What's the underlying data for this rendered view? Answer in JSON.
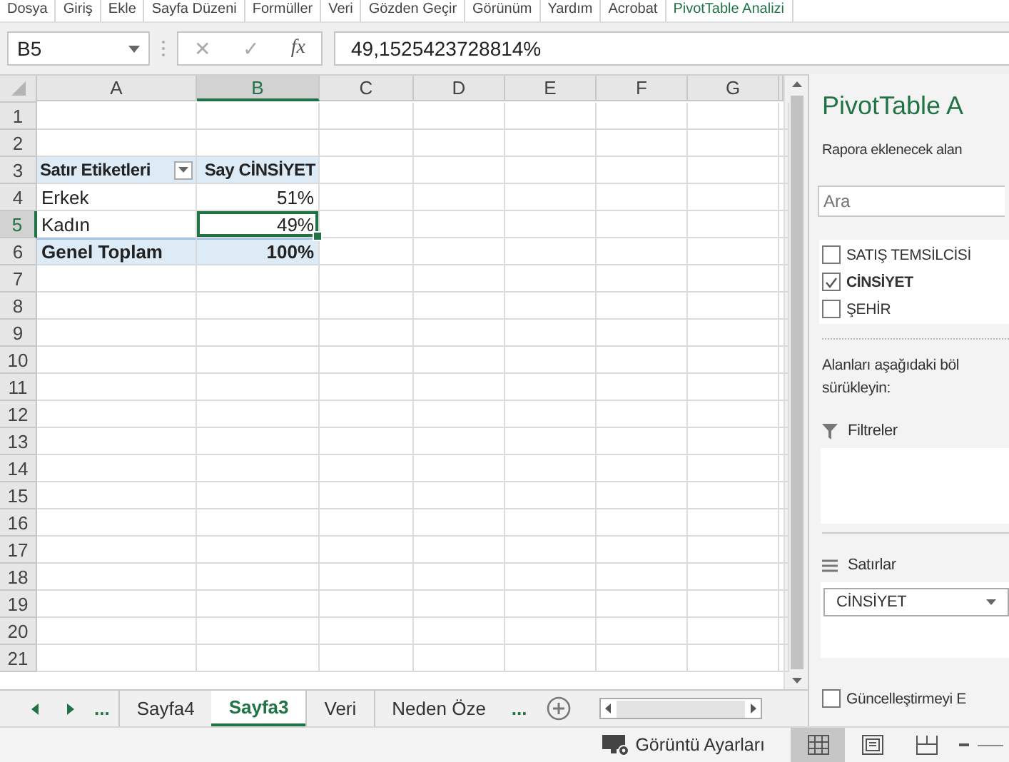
{
  "ribbon_tabs": [
    {
      "label": "Dosya",
      "kind": "plain"
    },
    {
      "label": "Giriş",
      "kind": "plain"
    },
    {
      "label": "Ekle",
      "kind": "plain"
    },
    {
      "label": "Sayfa Düzeni",
      "kind": "plain"
    },
    {
      "label": "Formüller",
      "kind": "plain"
    },
    {
      "label": "Veri",
      "kind": "plain"
    },
    {
      "label": "Gözden Geçir",
      "kind": "plain"
    },
    {
      "label": "Görünüm",
      "kind": "plain"
    },
    {
      "label": "Yardım",
      "kind": "plain"
    },
    {
      "label": "Acrobat",
      "kind": "plain"
    },
    {
      "label": "PivotTable Analizi",
      "kind": "contextual"
    }
  ],
  "formula_bar": {
    "name_box": "B5",
    "cancel": "✕",
    "enter": "✓",
    "function": "fx",
    "value": "49,1525423728814%"
  },
  "sheet": {
    "columns": [
      {
        "label": "A",
        "selected": false
      },
      {
        "label": "B",
        "selected": true
      },
      {
        "label": "C",
        "selected": false
      },
      {
        "label": "D",
        "selected": false
      },
      {
        "label": "E",
        "selected": false
      },
      {
        "label": "F",
        "selected": false
      },
      {
        "label": "G",
        "selected": false
      }
    ],
    "rows": [
      {
        "header": "1",
        "selected": false,
        "kind": "blank"
      },
      {
        "header": "2",
        "selected": false,
        "kind": "blank"
      },
      {
        "header": "3",
        "selected": false,
        "kind": "pivot_header",
        "cells": [
          {
            "text": "Satır Etiketleri",
            "selected": false
          },
          {
            "text": "Say CİNSİYET",
            "selected": false
          }
        ]
      },
      {
        "header": "4",
        "selected": false,
        "kind": "item",
        "cells": [
          {
            "text": "Erkek",
            "selected": false
          },
          {
            "text": "51%",
            "selected": false
          }
        ]
      },
      {
        "header": "5",
        "selected": true,
        "kind": "item",
        "cells": [
          {
            "text": "Kadın",
            "selected": false
          },
          {
            "text": "49%",
            "selected": true
          }
        ]
      },
      {
        "header": "6",
        "selected": false,
        "kind": "total",
        "cells": [
          {
            "text": "Genel Toplam",
            "selected": false
          },
          {
            "text": "100%",
            "selected": false
          }
        ]
      },
      {
        "header": "7",
        "selected": false,
        "kind": "blank"
      },
      {
        "header": "8",
        "selected": false,
        "kind": "blank"
      },
      {
        "header": "9",
        "selected": false,
        "kind": "blank"
      },
      {
        "header": "10",
        "selected": false,
        "kind": "blank"
      },
      {
        "header": "11",
        "selected": false,
        "kind": "blank"
      },
      {
        "header": "12",
        "selected": false,
        "kind": "blank"
      },
      {
        "header": "13",
        "selected": false,
        "kind": "blank"
      },
      {
        "header": "14",
        "selected": false,
        "kind": "blank"
      },
      {
        "header": "15",
        "selected": false,
        "kind": "blank"
      },
      {
        "header": "16",
        "selected": false,
        "kind": "blank"
      },
      {
        "header": "17",
        "selected": false,
        "kind": "blank"
      },
      {
        "header": "18",
        "selected": false,
        "kind": "blank"
      },
      {
        "header": "19",
        "selected": false,
        "kind": "blank"
      },
      {
        "header": "20",
        "selected": false,
        "kind": "blank"
      },
      {
        "header": "21",
        "selected": false,
        "kind": "blank"
      }
    ]
  },
  "sheet_tabs": {
    "more_left": "...",
    "tabs": [
      {
        "label": "Sayfa4",
        "selected": false
      },
      {
        "label": "Sayfa3",
        "selected": true
      },
      {
        "label": "Veri",
        "selected": false
      },
      {
        "label": "Neden Öze",
        "selected": false
      }
    ],
    "more_right": "..."
  },
  "pivot_pane": {
    "title": "PivotTable A",
    "subtitle": "Rapora eklenecek alan",
    "search": {
      "placeholder": "Ara"
    },
    "fields": [
      {
        "label": "SATIŞ TEMSİLCİSİ",
        "checked": false
      },
      {
        "label": "CİNSİYET",
        "checked": true
      },
      {
        "label": "ŞEHİR",
        "checked": false
      }
    ],
    "instruction_lines": [
      "Alanları aşağıdaki böl",
      "sürükleyin:"
    ],
    "areas": [
      {
        "kind": "filters",
        "label": "Filtreler"
      },
      {
        "kind": "rows",
        "label": "Satırlar",
        "items": [
          "CİNSİYET"
        ]
      }
    ],
    "defer_update": {
      "label": "Güncelleştirmeyi E",
      "checked": false
    }
  },
  "status_bar": {
    "display_settings": "Görüntü Ayarları",
    "views": [
      {
        "kind": "normal",
        "selected": true
      },
      {
        "kind": "page_layout",
        "selected": false
      },
      {
        "kind": "page_break",
        "selected": false
      }
    ]
  }
}
